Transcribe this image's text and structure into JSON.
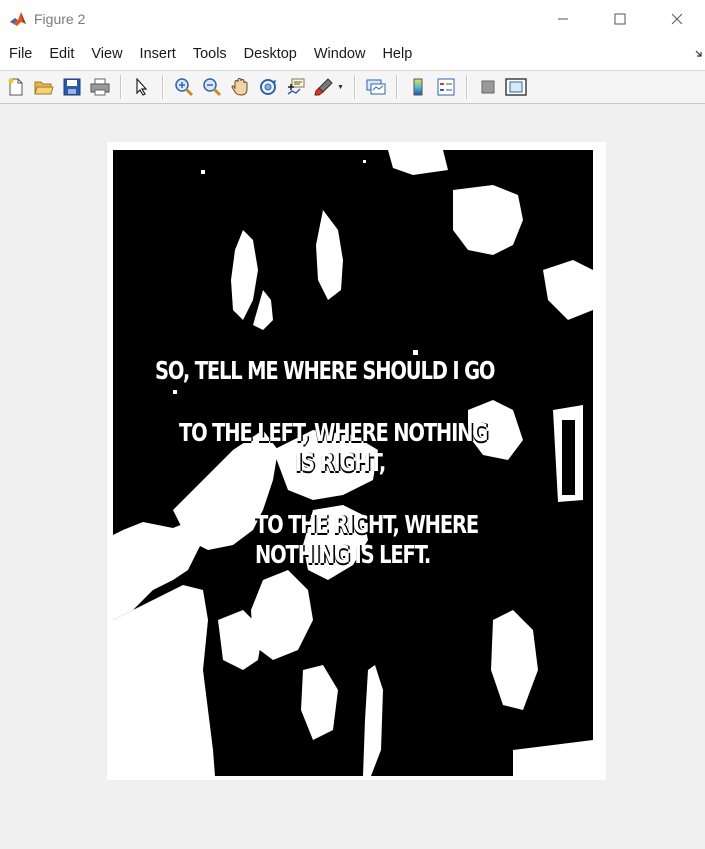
{
  "window": {
    "title": "Figure 2",
    "controls": {
      "minimize": "—",
      "maximize": "☐",
      "close": "✕"
    }
  },
  "menu": {
    "items": [
      "File",
      "Edit",
      "View",
      "Insert",
      "Tools",
      "Desktop",
      "Window",
      "Help"
    ],
    "overflow_arrow": "⬎"
  },
  "toolbar": {
    "buttons": [
      "new-figure-icon",
      "open-file-icon",
      "save-icon",
      "print-icon",
      "edit-plot-arrow-icon",
      "zoom-in-icon",
      "zoom-out-icon",
      "pan-hand-icon",
      "rotate-3d-icon",
      "data-cursor-icon",
      "brush-icon",
      "link-plot-icon",
      "colorbar-icon",
      "legend-icon",
      "hide-plot-tools-icon",
      "show-plot-tools-icon"
    ]
  },
  "figure": {
    "image": {
      "description_kind": "binarized black-and-white image",
      "text_lines": [
        "SO, TELL ME WHERE SHOULD I GO",
        "TO THE LEFT, WHERE NOTHING",
        "IS RIGHT,",
        "TO THE RIGHT, WHERE",
        "NOTHING IS LEFT."
      ]
    }
  },
  "colors": {
    "window_bg": "#f0f0f0",
    "titlebar_bg": "#ffffff",
    "image_fg": "#000000",
    "image_bg": "#ffffff"
  }
}
